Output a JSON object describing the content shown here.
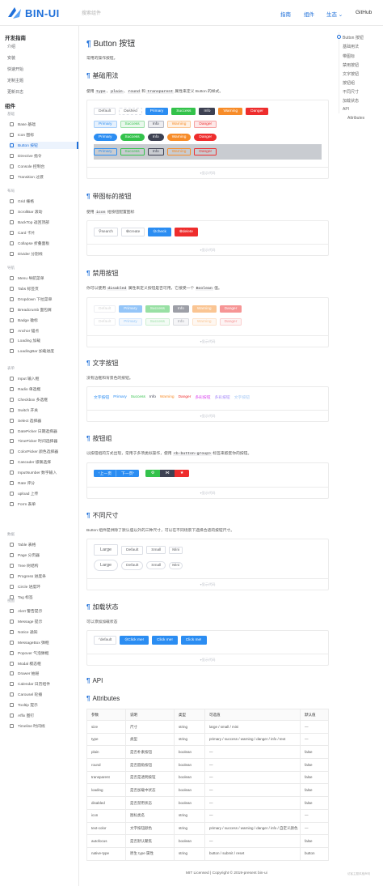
{
  "header": {
    "logo_text": "BIN-UI",
    "search_placeholder": "搜索组件",
    "nav": [
      "指南",
      "组件",
      "生态",
      "GitHub"
    ]
  },
  "sidebar": {
    "groups": [
      {
        "title": "开发指南",
        "items": [
          "介绍",
          "安装",
          "快速开始",
          "定制主题",
          "更新日志"
        ]
      },
      {
        "title": "组件"
      }
    ],
    "categories": [
      "基础",
      "布局",
      "导航",
      "表单",
      "数据",
      "视图"
    ],
    "components": [
      "Base 基础",
      "Icon 图标",
      "Button 按钮",
      "Directive 指令",
      "Console 控制台",
      "Transition 过渡",
      "Grid 栅格",
      "ScrollBar 滚动",
      "BackTop 返回顶部",
      "Card 卡片",
      "Collapse 折叠面板",
      "Divider 分割线",
      "Menu 导航菜单",
      "Tabs 标签页",
      "Dropdown 下拉菜单",
      "Breadcrumb 面包屑",
      "Badge 徽标",
      "Anchor 锚点",
      "Loading 加载",
      "LoadingBar 加载进度",
      "Input 输入框",
      "Radio 单选框",
      "Checkbox 多选框",
      "Switch 开关",
      "Select 选择器",
      "DatePicker 日期选择器",
      "TimePicker 时间选择器",
      "ColorPicker 颜色选择器",
      "Cascader 级联选择",
      "InputNumber 数字输入",
      "Rate 评分",
      "upload 上传",
      "Form 表单",
      "Table 表格",
      "Page 分页器",
      "Tree 树结构",
      "Progress 进度条",
      "Circle 进度环",
      "Tag 标签",
      "Alert 警告提示",
      "Message 提示",
      "Notice 通知",
      "MessageBox 弹框",
      "Popover 气泡弹框",
      "Modal 模态框",
      "Drawer 抽屉",
      "Calendar 日历组件",
      "Carousel 轮播",
      "Tooltip 提示",
      "Affix 图钉",
      "Timeline 时间线"
    ],
    "active": "Button 按钮"
  },
  "toc": [
    "Button 按钮",
    "基础用法",
    "带图标",
    "禁用按钮",
    "文字按钮",
    "按钮组",
    "不同尺寸",
    "加载状态",
    "API",
    "Attributes"
  ],
  "main": {
    "title": "Button 按钮",
    "intro": "常用的操作按钮。",
    "s1_title": "基础用法",
    "s1_desc": [
      "使用",
      "type",
      "、",
      "plain",
      "、",
      "round",
      "和",
      "transparent",
      "属性来定义 Button 的样式。"
    ],
    "btns": [
      "Default",
      "Dashed",
      "Primary",
      "Success",
      "Info",
      "Warning",
      "Danger"
    ],
    "show_code": "显示代码",
    "s2_title": "带图标的按钮",
    "s2_desc": [
      "使用",
      "icon",
      "给按钮配置图标"
    ],
    "icon_btns": [
      "search",
      "create",
      "check",
      "delete"
    ],
    "s3_title": "禁用按钮",
    "s3_desc": [
      "你可以使用",
      "disabled",
      "属性来定义按钮是否可用，它接受一个",
      "Boolean",
      "值。"
    ],
    "s4_title": "文字按钮",
    "s4_desc": "没有边框和背景色的按钮。",
    "text_btns": [
      "文字按钮",
      "Primary",
      "Success",
      "Info",
      "Warning",
      "Danger",
      "多彩按钮",
      "多彩按钮",
      "文字按钮"
    ],
    "s5_title": "按钮组",
    "s5_desc": [
      "以按钮组的方式出现，常用于多项类似操作，使用",
      "<b-button-group>",
      "标签来嵌套你的按钮。"
    ],
    "group1": [
      "上一页",
      "下一页"
    ],
    "s6_title": "不同尺寸",
    "s6_desc": "Button 组件提供除了默认值以外的三种尺寸，可以在不同场景下选择合适的按钮尺寸。",
    "sizes": [
      "Large",
      "Default",
      "Small",
      "Mini"
    ],
    "s7_title": "加载状态",
    "s7_desc": "可以添加加载状态",
    "loading_btns": [
      "default",
      "Click me!",
      "Click me!",
      "Click me!"
    ],
    "api_title": "API",
    "attr_title": "Attributes"
  },
  "table": {
    "headers": [
      "参数",
      "说明",
      "类型",
      "可选值",
      "默认值"
    ],
    "rows": [
      [
        "size",
        "尺寸",
        "string",
        "large / small / mini",
        "—"
      ],
      [
        "type",
        "类型",
        "string",
        "primary / success / warning / danger / info / text",
        "—"
      ],
      [
        "plain",
        "是否朴素按钮",
        "boolean",
        "—",
        "false"
      ],
      [
        "round",
        "是否圆角按钮",
        "boolean",
        "—",
        "false"
      ],
      [
        "transparent",
        "是否是透明按钮",
        "boolean",
        "—",
        "false"
      ],
      [
        "loading",
        "是否加载中状态",
        "boolean",
        "—",
        "false"
      ],
      [
        "disabled",
        "是否禁用状态",
        "boolean",
        "—",
        "false"
      ],
      [
        "icon",
        "图标类名",
        "string",
        "—",
        "—"
      ],
      [
        "text-color",
        "文字按钮颜色",
        "string",
        "primary / success / warning / danger / info / 自定义颜色",
        "—"
      ],
      [
        "autofocus",
        "是否默认聚焦",
        "boolean",
        "—",
        "false"
      ],
      [
        "native-type",
        "原生 type 属性",
        "string",
        "button / submit / reset",
        "button"
      ]
    ]
  },
  "footer": {
    "text": "MIT Licensed | Copyright © 2019-present bin-ui",
    "right": "访客主题风格声明"
  },
  "colors": {
    "accent": "#1e6fd9",
    "primary": "#2b8df2",
    "success": "#33c24b",
    "info": "#3d4152",
    "warning": "#f78c29",
    "danger": "#ee2d2d"
  }
}
